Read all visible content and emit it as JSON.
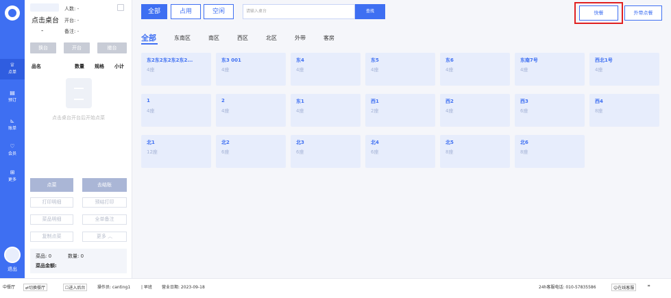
{
  "rail": {
    "items": [
      {
        "icon": "crown-icon",
        "glyph": "♕",
        "label": "点单"
      },
      {
        "icon": "reserve-icon",
        "glyph": "▤",
        "label": "预订"
      },
      {
        "icon": "chart-icon",
        "glyph": "⊾",
        "label": "账单"
      },
      {
        "icon": "member-icon",
        "glyph": "♡",
        "label": "会员"
      },
      {
        "icon": "more-icon",
        "glyph": "⊞",
        "label": "更多"
      }
    ],
    "logout": "退出"
  },
  "order": {
    "table_title": "点击桌台",
    "seat": "-",
    "people": "人数: -",
    "open_time": "开台: -",
    "remark": "备注: -",
    "btn_change": "换台",
    "btn_open": "开台",
    "btn_cancel": "撤台",
    "col_name": "品名",
    "col_qty": "数量",
    "col_spec": "规格",
    "col_subtotal": "小计",
    "empty_text": "点击桌台开台后开始点菜",
    "btn_order": "点菜",
    "btn_checkout": "去结账",
    "btn_print_detail": "打印明细",
    "btn_pre_print": "预结打印",
    "btn_dish_detail": "菜品明细",
    "btn_all_remark": "全单备注",
    "btn_copy": "复制点菜",
    "btn_more": "更多 ︿",
    "dish_count": "菜品: 0",
    "qty_count": "数量: 0",
    "dish_amount": "菜品金额:"
  },
  "filters": {
    "all": "全部",
    "occupied": "占用",
    "free": "空闲"
  },
  "search": {
    "placeholder": "请输入桌台",
    "button": "查找"
  },
  "top_actions": {
    "quick": "快餐",
    "takeout": "外带点餐"
  },
  "areas": [
    "全部",
    "东南区",
    "南区",
    "西区",
    "北区",
    "外带",
    "客房"
  ],
  "tables": [
    {
      "name": "东2东2东2东2东2...",
      "seats": "4座"
    },
    {
      "name": "东3 001",
      "seats": "4座"
    },
    {
      "name": "东4",
      "seats": "4座"
    },
    {
      "name": "东5",
      "seats": "4座"
    },
    {
      "name": "东6",
      "seats": "4座"
    },
    {
      "name": "东南7号",
      "seats": "4座"
    },
    {
      "name": "西北1号",
      "seats": "4座"
    },
    {
      "name": "1",
      "seats": "4座"
    },
    {
      "name": "2",
      "seats": "4座"
    },
    {
      "name": "东1",
      "seats": "4座"
    },
    {
      "name": "西1",
      "seats": "2座"
    },
    {
      "name": "西2",
      "seats": "4座"
    },
    {
      "name": "西3",
      "seats": "6座"
    },
    {
      "name": "西4",
      "seats": "8座"
    },
    {
      "name": "北1",
      "seats": "12座"
    },
    {
      "name": "北2",
      "seats": "6座"
    },
    {
      "name": "北3",
      "seats": "6座"
    },
    {
      "name": "北4",
      "seats": "6座"
    },
    {
      "name": "北5",
      "seats": "8座"
    },
    {
      "name": "北6",
      "seats": "8座"
    }
  ],
  "status": {
    "restaurant": "中餐厅",
    "switch": "⇄切换餐厅",
    "backend": "☐进入后台",
    "operator": "操作员: canting1",
    "shift": "| 早班",
    "biz_date": "营业日期: 2023-09-18",
    "hotline": "24h客服电话: 010-57835586",
    "online": "☺在线客服",
    "scan": "⌗"
  },
  "colors": {
    "primary": "#3e6ff2",
    "card": "#e7edfc",
    "highlight": "#e02020"
  }
}
